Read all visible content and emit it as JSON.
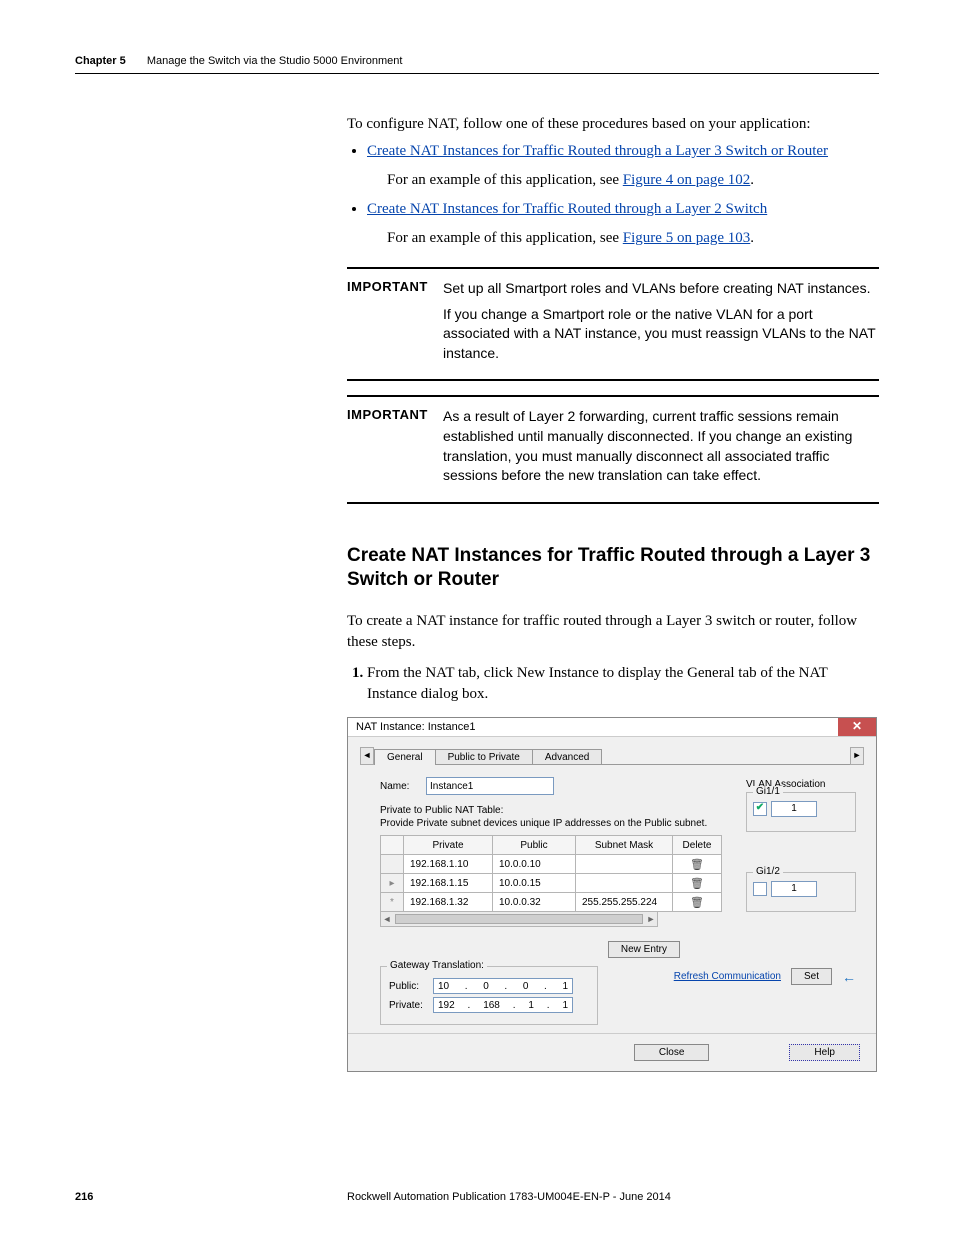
{
  "header": {
    "chapter": "Chapter 5",
    "title": "Manage the Switch via the Studio 5000 Environment"
  },
  "intro": "To configure NAT, follow one of these procedures based on your application:",
  "bullets": {
    "b1": "Create NAT Instances for Traffic Routed through a Layer 3 Switch or Router",
    "b1_sub_a": "For an example of this application, see ",
    "b1_sub_link": "Figure 4 on page 102",
    "b1_sub_b": ".",
    "b2": "Create NAT Instances for Traffic Routed through a Layer 2 Switch",
    "b2_sub_a": "For an example of this application, see ",
    "b2_sub_link": "Figure 5 on page 103",
    "b2_sub_b": "."
  },
  "important1": {
    "label": "IMPORTANT",
    "p1": "Set up all Smartport roles and VLANs before creating NAT instances.",
    "p2": "If you change a Smartport role or the native VLAN for a port associated with a NAT instance, you must reassign VLANs to the NAT instance."
  },
  "important2": {
    "label": "IMPORTANT",
    "p1": "As a result of Layer 2 forwarding, current traffic sessions remain established until manually disconnected. If you change an existing translation, you must manually disconnect all associated traffic sessions before the new translation can take effect."
  },
  "section_heading": "Create NAT Instances for Traffic Routed through a Layer 3 Switch or Router",
  "section_para": "To create a NAT instance for traffic routed through a Layer 3 switch or router, follow these steps.",
  "step1": "From the NAT tab, click New Instance to display the General tab of the NAT Instance dialog box.",
  "dialog": {
    "title": "NAT Instance: Instance1",
    "tabs": {
      "general": "General",
      "p2p": "Public to Private",
      "advanced": "Advanced"
    },
    "name_label": "Name:",
    "name_value": "Instance1",
    "table_label": "Private to Public NAT Table:",
    "table_hint": "Provide Private subnet devices unique IP addresses on the Public subnet.",
    "cols": {
      "private": "Private",
      "public": "Public",
      "mask": "Subnet Mask",
      "delete": "Delete"
    },
    "rows": [
      {
        "private": "192.168.1.10",
        "public": "10.0.0.10",
        "mask": ""
      },
      {
        "private": "192.168.1.15",
        "public": "10.0.0.15",
        "mask": ""
      },
      {
        "private": "192.168.1.32",
        "public": "10.0.0.32",
        "mask": "255.255.255.224"
      }
    ],
    "vlan_label": "VLAN Association",
    "vlan1": {
      "legend": "Gi1/1",
      "checked": true,
      "value": "1"
    },
    "vlan2": {
      "legend": "Gi1/2",
      "checked": false,
      "value": "1"
    },
    "new_entry": "New Entry",
    "gw_legend": "Gateway Translation:",
    "gw_public_label": "Public:",
    "gw_public": [
      "10",
      "0",
      "0",
      "1"
    ],
    "gw_private_label": "Private:",
    "gw_private": [
      "192",
      "168",
      "1",
      "1"
    ],
    "refresh": "Refresh Communication",
    "set": "Set",
    "close": "Close",
    "help": "Help"
  },
  "footer": {
    "page": "216",
    "pub": "Rockwell Automation Publication 1783-UM004E-EN-P - June 2014"
  }
}
